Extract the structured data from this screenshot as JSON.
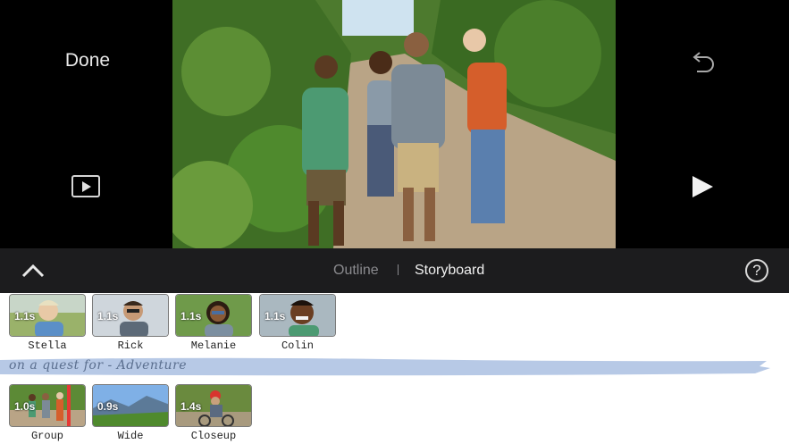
{
  "header": {
    "done_label": "Done",
    "fullscreen_icon": "fullscreen-play-icon",
    "undo_icon": "undo-icon",
    "play_icon": "play-icon"
  },
  "toolbar": {
    "collapse_icon": "chevron-up-icon",
    "tabs": [
      {
        "label": "Outline",
        "selected": false
      },
      {
        "label": "Storyboard",
        "selected": true
      }
    ],
    "help_label": "?"
  },
  "storyboard": {
    "row1": [
      {
        "duration": "1.1s",
        "label": "Stella"
      },
      {
        "duration": "1.1s",
        "label": "Rick"
      },
      {
        "duration": "1.1s",
        "label": "Melanie"
      },
      {
        "duration": "1.1s",
        "label": "Colin"
      }
    ],
    "title_banner": "on a quest for - Adventure",
    "row2": [
      {
        "duration": "1.0s",
        "label": "Group"
      },
      {
        "duration": "0.9s",
        "label": "Wide"
      },
      {
        "duration": "1.4s",
        "label": "Closeup"
      }
    ]
  },
  "colors": {
    "top_bg": "#000000",
    "toolbar_bg": "#1c1c1e",
    "banner": "#b7c9e6"
  }
}
